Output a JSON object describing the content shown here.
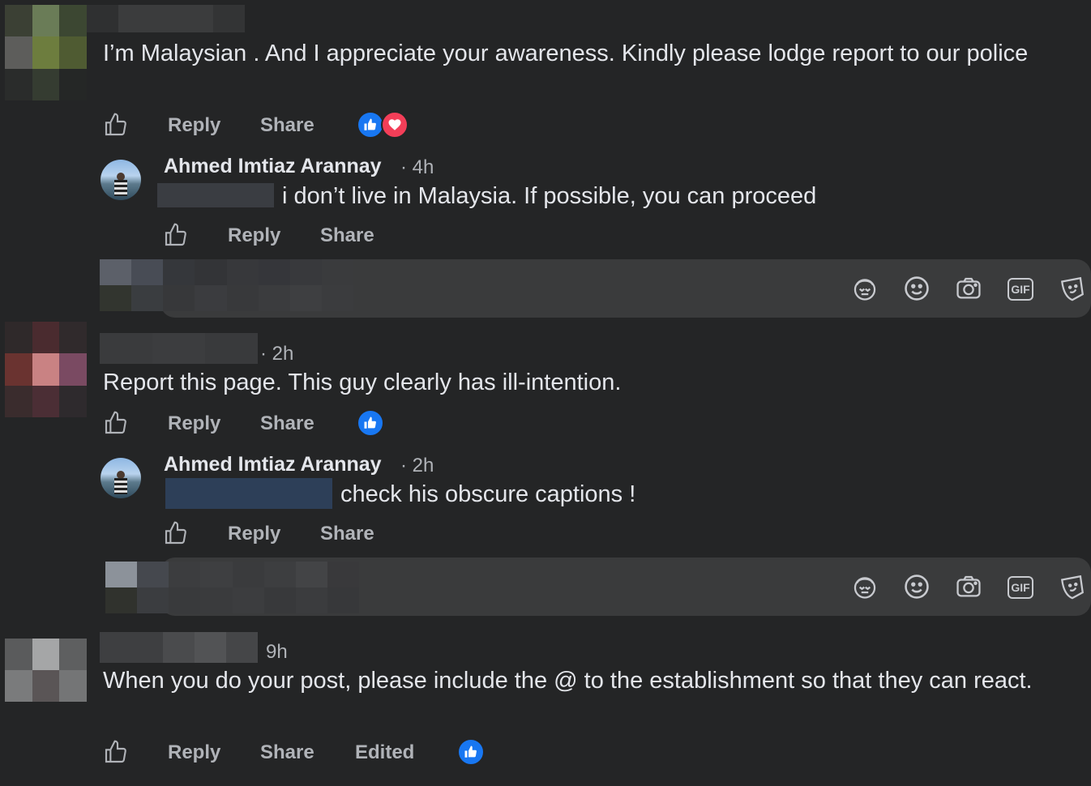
{
  "comments": [
    {
      "text": "I’m Malaysian . And I appreciate your awareness. Kindly please lodge report to our police",
      "actions": {
        "reply": "Reply",
        "share": "Share"
      },
      "reactions": [
        "like",
        "love"
      ],
      "reply": {
        "author": "Ahmed Imtiaz Arannay",
        "time": "· 4h",
        "text": "i don’t live in Malaysia. If possible, you can proceed",
        "actions": {
          "reply": "Reply",
          "share": "Share"
        }
      }
    },
    {
      "time": "· 2h",
      "text": "Report this page. This guy clearly has ill-intention.",
      "actions": {
        "reply": "Reply",
        "share": "Share"
      },
      "reactions": [
        "like"
      ],
      "reply": {
        "author": "Ahmed Imtiaz Arannay",
        "time": "· 2h",
        "text": "check his obscure captions !",
        "actions": {
          "reply": "Reply",
          "share": "Share"
        }
      }
    },
    {
      "time": "9h",
      "text": "When you do your post, please include the @ to the establishment so that they can react.",
      "actions": {
        "reply": "Reply",
        "share": "Share",
        "edited": "Edited"
      },
      "reactions": [
        "like"
      ]
    }
  ],
  "composer": {
    "icons": [
      "avatar-sticker-icon",
      "emoji-icon",
      "camera-icon",
      "gif-icon",
      "sticker-icon"
    ],
    "gif_label": "GIF"
  },
  "colors": {
    "background": "#242526",
    "text": "#e4e6eb",
    "muted": "#b0b3b8",
    "like": "#1877f2",
    "love": "#f33e58"
  }
}
